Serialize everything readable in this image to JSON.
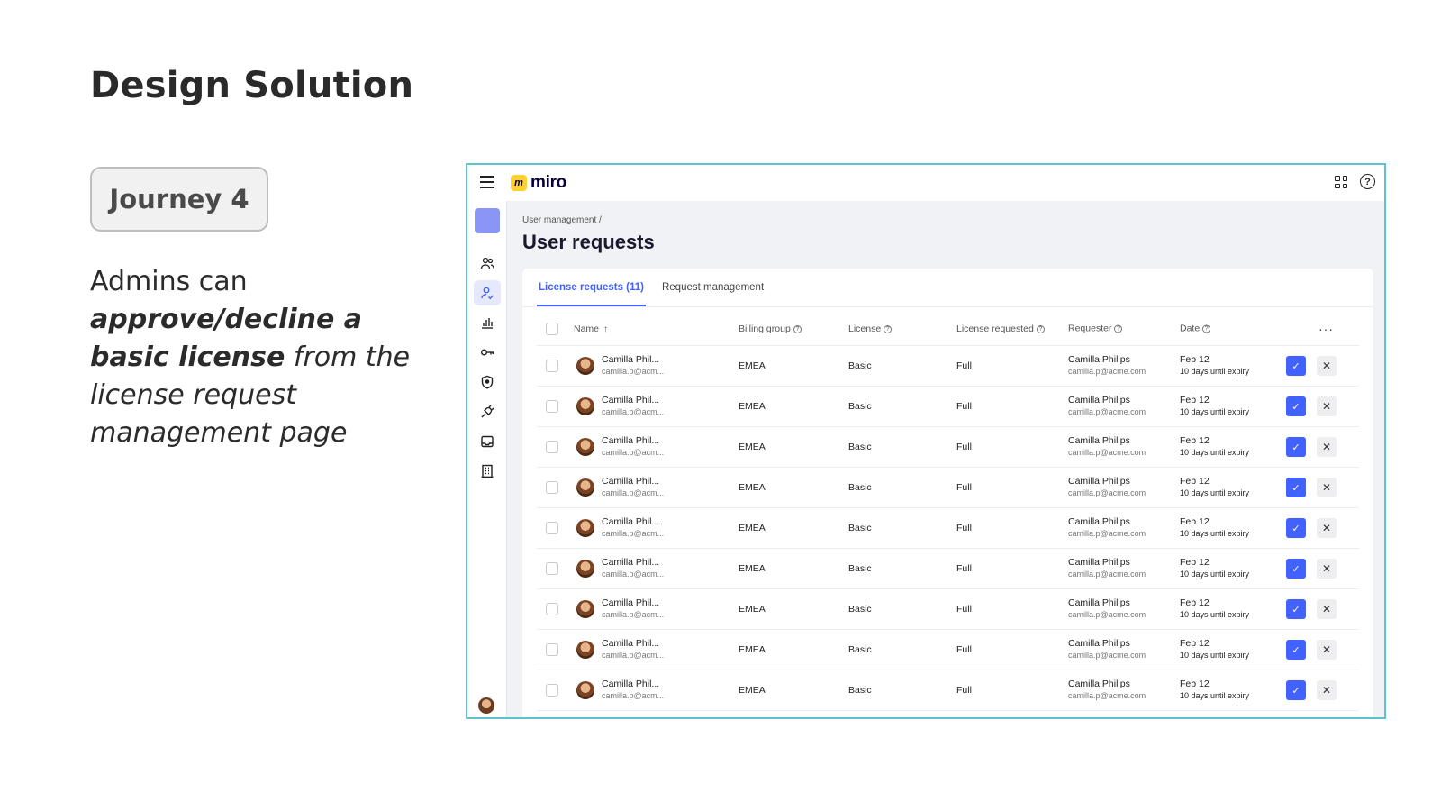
{
  "slide": {
    "title": "Design Solution",
    "badge": "Journey 4",
    "desc_1": "Admins can ",
    "desc_2": "approve/decline a basic license",
    "desc_3": " from the license request management page"
  },
  "app": {
    "logo_mark": "m",
    "logo_text": "miro",
    "help_glyph": "?",
    "breadcrumb": "User management",
    "breadcrumb_sep": "/",
    "page_title": "User requests",
    "tabs": [
      {
        "label": "License requests (11)"
      },
      {
        "label": "Request management"
      }
    ],
    "columns": {
      "name": "Name",
      "sort_glyph": "↑",
      "billing": "Billing group",
      "license": "License",
      "license_requested": "License requested",
      "requester": "Requester",
      "date": "Date",
      "help_glyph": "?",
      "more": "···"
    },
    "approve_glyph": "✓",
    "decline_glyph": "✕",
    "colors": {
      "accent": "#4262ff",
      "frame": "#5ec2cc",
      "logo": "#ffd02f"
    },
    "rows": [
      {
        "name": "Camilla Phil...",
        "email": "camilla.p@acm...",
        "billing": "EMEA",
        "license": "Basic",
        "license_requested": "Full",
        "requester": "Camilla Philips",
        "requester_email": "camilla.p@acme.com",
        "date": "Feb 12",
        "expiry": "10 days until expiry"
      },
      {
        "name": "Camilla Phil...",
        "email": "camilla.p@acm...",
        "billing": "EMEA",
        "license": "Basic",
        "license_requested": "Full",
        "requester": "Camilla Philips",
        "requester_email": "camilla.p@acme.com",
        "date": "Feb 12",
        "expiry": "10 days until expiry"
      },
      {
        "name": "Camilla Phil...",
        "email": "camilla.p@acm...",
        "billing": "EMEA",
        "license": "Basic",
        "license_requested": "Full",
        "requester": "Camilla Philips",
        "requester_email": "camilla.p@acme.com",
        "date": "Feb 12",
        "expiry": "10 days until expiry"
      },
      {
        "name": "Camilla Phil...",
        "email": "camilla.p@acm...",
        "billing": "EMEA",
        "license": "Basic",
        "license_requested": "Full",
        "requester": "Camilla Philips",
        "requester_email": "camilla.p@acme.com",
        "date": "Feb 12",
        "expiry": "10 days until expiry"
      },
      {
        "name": "Camilla Phil...",
        "email": "camilla.p@acm...",
        "billing": "EMEA",
        "license": "Basic",
        "license_requested": "Full",
        "requester": "Camilla Philips",
        "requester_email": "camilla.p@acme.com",
        "date": "Feb 12",
        "expiry": "10 days until expiry"
      },
      {
        "name": "Camilla Phil...",
        "email": "camilla.p@acm...",
        "billing": "EMEA",
        "license": "Basic",
        "license_requested": "Full",
        "requester": "Camilla Philips",
        "requester_email": "camilla.p@acme.com",
        "date": "Feb 12",
        "expiry": "10 days until expiry"
      },
      {
        "name": "Camilla Phil...",
        "email": "camilla.p@acm...",
        "billing": "EMEA",
        "license": "Basic",
        "license_requested": "Full",
        "requester": "Camilla Philips",
        "requester_email": "camilla.p@acme.com",
        "date": "Feb 12",
        "expiry": "10 days until expiry"
      },
      {
        "name": "Camilla Phil...",
        "email": "camilla.p@acm...",
        "billing": "EMEA",
        "license": "Basic",
        "license_requested": "Full",
        "requester": "Camilla Philips",
        "requester_email": "camilla.p@acme.com",
        "date": "Feb 12",
        "expiry": "10 days until expiry"
      },
      {
        "name": "Camilla Phil...",
        "email": "camilla.p@acm...",
        "billing": "EMEA",
        "license": "Basic",
        "license_requested": "Full",
        "requester": "Camilla Philips",
        "requester_email": "camilla.p@acme.com",
        "date": "Feb 12",
        "expiry": "10 days until expiry"
      }
    ]
  }
}
